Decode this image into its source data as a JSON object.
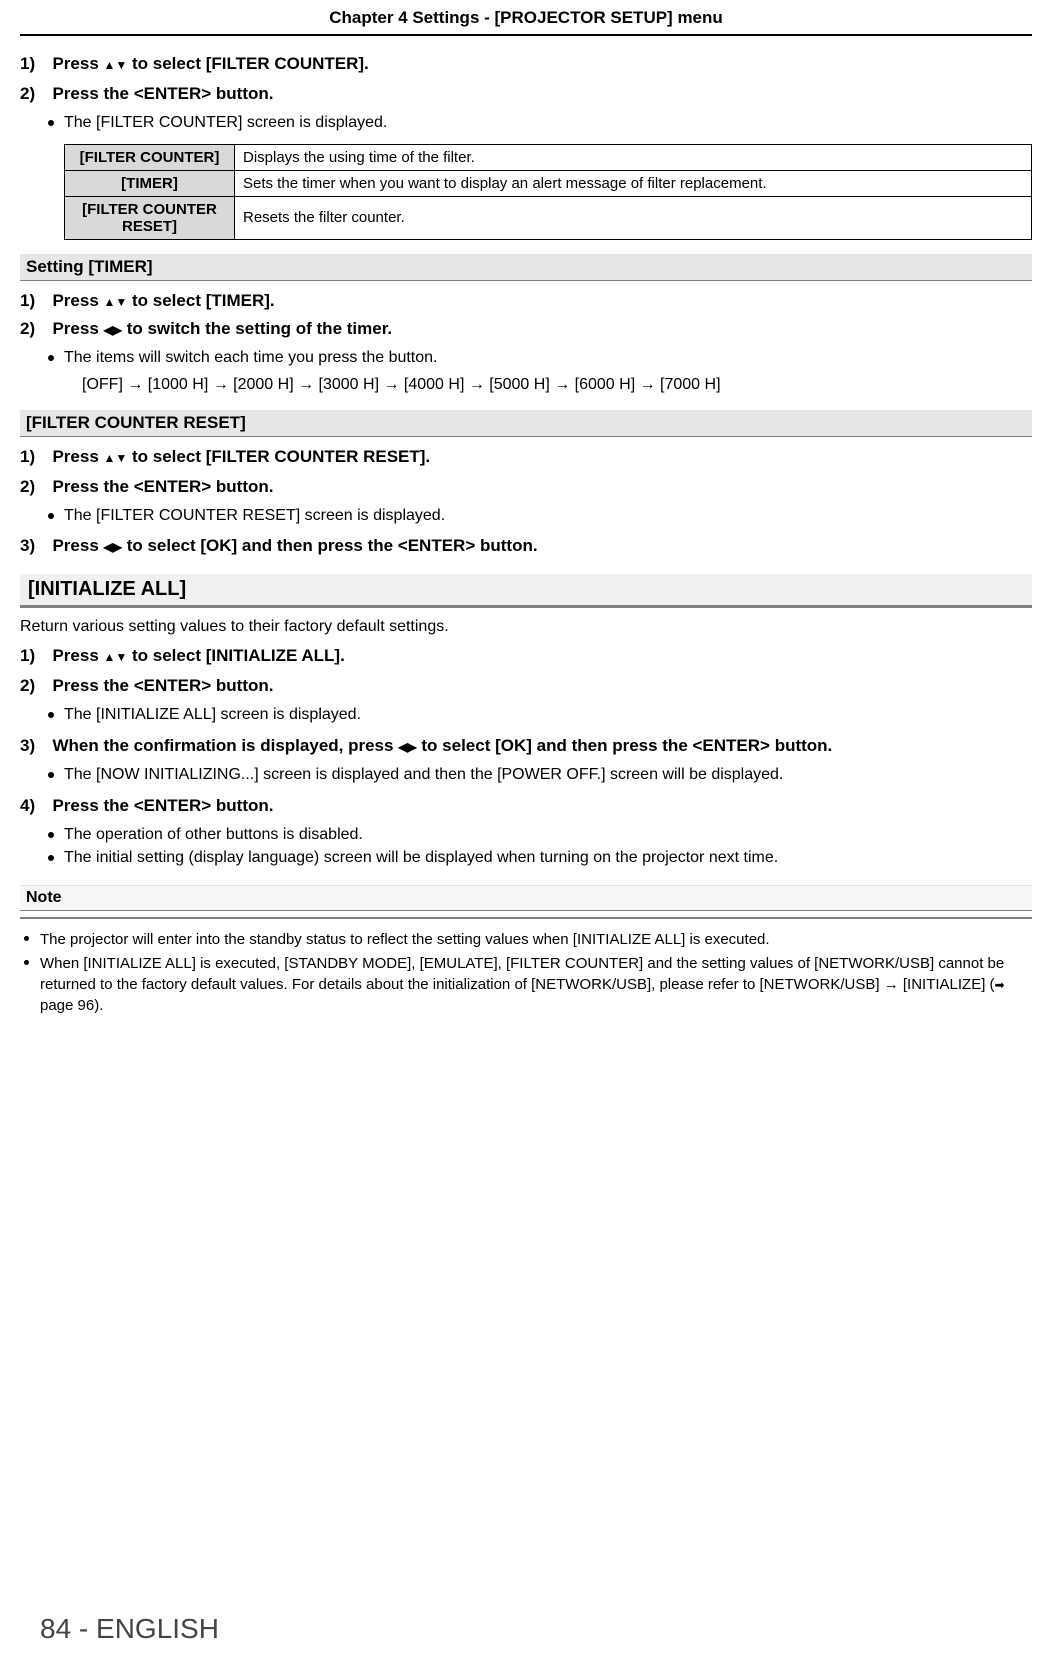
{
  "header": {
    "chapter": "Chapter 4   Settings - [PROJECTOR SETUP] menu"
  },
  "sectionA": {
    "step1_num": "1)",
    "step1_text_a": "Press ",
    "step1_text_b": " to select [FILTER COUNTER].",
    "step2_num": "2)",
    "step2_text": "Press the <ENTER> button.",
    "step2_sub1": "The [FILTER COUNTER] screen is displayed.",
    "table": {
      "r1_label": "[FILTER COUNTER]",
      "r1_desc": "Displays the using time of the filter.",
      "r2_label": "[TIMER]",
      "r2_desc": "Sets the timer when you want to display an alert message of filter replacement.",
      "r3_label": "[FILTER COUNTER RESET]",
      "r3_desc": "Resets the filter counter."
    }
  },
  "sectionB": {
    "heading": "Setting [TIMER]",
    "step1_num": "1)",
    "step1_text_a": "Press ",
    "step1_text_b": " to select [TIMER].",
    "step2_num": "2)",
    "step2_text_a": "Press ",
    "step2_text_b": " to switch the setting of the timer.",
    "step2_sub1": "The items will switch each time you press the button.",
    "step2_sub2": "[OFF] → [1000 H] → [2000 H] → [3000 H] → [4000 H] → [5000 H] → [6000 H] → [7000 H]"
  },
  "sectionC": {
    "heading": "[FILTER COUNTER RESET]",
    "step1_num": "1)",
    "step1_text_a": "Press ",
    "step1_text_b": " to select [FILTER COUNTER RESET].",
    "step2_num": "2)",
    "step2_text": "Press the <ENTER> button.",
    "step2_sub1": "The [FILTER COUNTER RESET] screen is displayed.",
    "step3_num": "3)",
    "step3_text_a": "Press ",
    "step3_text_b": " to select [OK] and then press the <ENTER> button."
  },
  "sectionD": {
    "heading": "[INITIALIZE ALL]",
    "intro": "Return various setting values to their factory default settings.",
    "step1_num": "1)",
    "step1_text_a": "Press ",
    "step1_text_b": " to select [INITIALIZE ALL].",
    "step2_num": "2)",
    "step2_text": "Press the <ENTER> button.",
    "step2_sub1": "The [INITIALIZE ALL] screen is displayed.",
    "step3_num": "3)",
    "step3_text_a": "When the confirmation is displayed, press ",
    "step3_text_b": " to select [OK] and then press the <ENTER> button.",
    "step3_sub1": "The [NOW INITIALIZING...] screen is displayed and then the [POWER OFF.] screen will be displayed.",
    "step4_num": "4)",
    "step4_text": "Press the <ENTER> button.",
    "step4_sub1": "The operation of other buttons is disabled.",
    "step4_sub2": "The initial setting (display language) screen will be displayed when turning on the projector next time."
  },
  "note": {
    "heading": "Note",
    "item1": "The projector will enter into the standby status to reflect the setting values when [INITIALIZE ALL] is executed.",
    "item2_a": "When [INITIALIZE ALL] is executed, [STANDBY MODE], [EMULATE], [FILTER COUNTER] and the setting values of [NETWORK/USB] cannot be returned to the factory default values. For details about the initialization of [NETWORK/USB], please refer to [NETWORK/USB] → [INITIALIZE] (",
    "item2_b": " page 96)."
  },
  "footer": {
    "page": "84 - ENGLISH"
  }
}
